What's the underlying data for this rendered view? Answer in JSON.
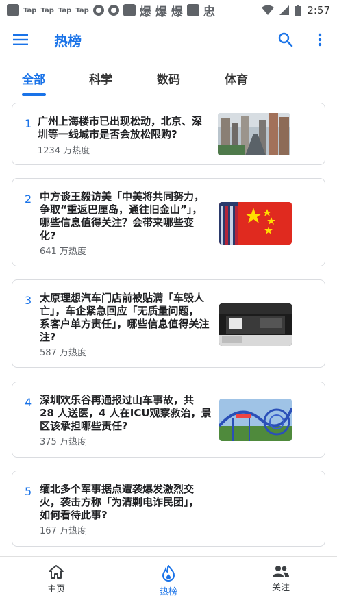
{
  "status_bar": {
    "tap_labels": [
      "Tap",
      "Tap",
      "Tap",
      "Tap"
    ],
    "cn_icons": [
      "爆",
      "爆",
      "爆",
      "忠"
    ],
    "time": "2:57"
  },
  "app_bar": {
    "title": "热榜",
    "accent": "#1a73e8"
  },
  "tabs": [
    {
      "label": "全部",
      "active": true
    },
    {
      "label": "科学",
      "active": false
    },
    {
      "label": "数码",
      "active": false
    },
    {
      "label": "体育",
      "active": false
    }
  ],
  "items": [
    {
      "rank": "1",
      "title_lines": [
        "广州上海楼市已出现松动，北京、深",
        "圳等一线城市是否会放松限购?"
      ],
      "heat": "1234 万热度",
      "image": "city-skyline"
    },
    {
      "rank": "2",
      "title_lines": [
        "中方谈王毅访美「中美将共同努力，",
        "争取“重返巴厘岛，通往旧金山”」，",
        "哪些信息值得关注？会带来哪些变",
        "化?"
      ],
      "heat": "641 万热度",
      "image": "flags"
    },
    {
      "rank": "3",
      "title_lines": [
        "太原理想汽车门店前被贴满「车毁人",
        "亡」，车企紧急回应「无质量问题，",
        "系客户单方责任」，哪些信息值得关注",
        "注?"
      ],
      "heat": "587 万热度",
      "image": "car-store"
    },
    {
      "rank": "4",
      "title_lines": [
        "深圳欢乐谷再通报过山车事故，共",
        "28 人送医，4 人在ICU观察救治，景",
        "区该承担哪些责任?"
      ],
      "heat": "375 万热度",
      "image": "roller-coaster"
    },
    {
      "rank": "5",
      "title_lines": [
        "缅北多个军事据点遭袭爆发激烈交",
        "火，袭击方称「为清剿电诈民团」，",
        "如何看待此事?"
      ],
      "heat": "167 万热度",
      "image": "none"
    }
  ],
  "bottom_nav": [
    {
      "label": "主页",
      "icon": "home-icon",
      "active": false
    },
    {
      "label": "热榜",
      "icon": "flame-icon",
      "active": true
    },
    {
      "label": "关注",
      "icon": "people-icon",
      "active": false
    }
  ]
}
